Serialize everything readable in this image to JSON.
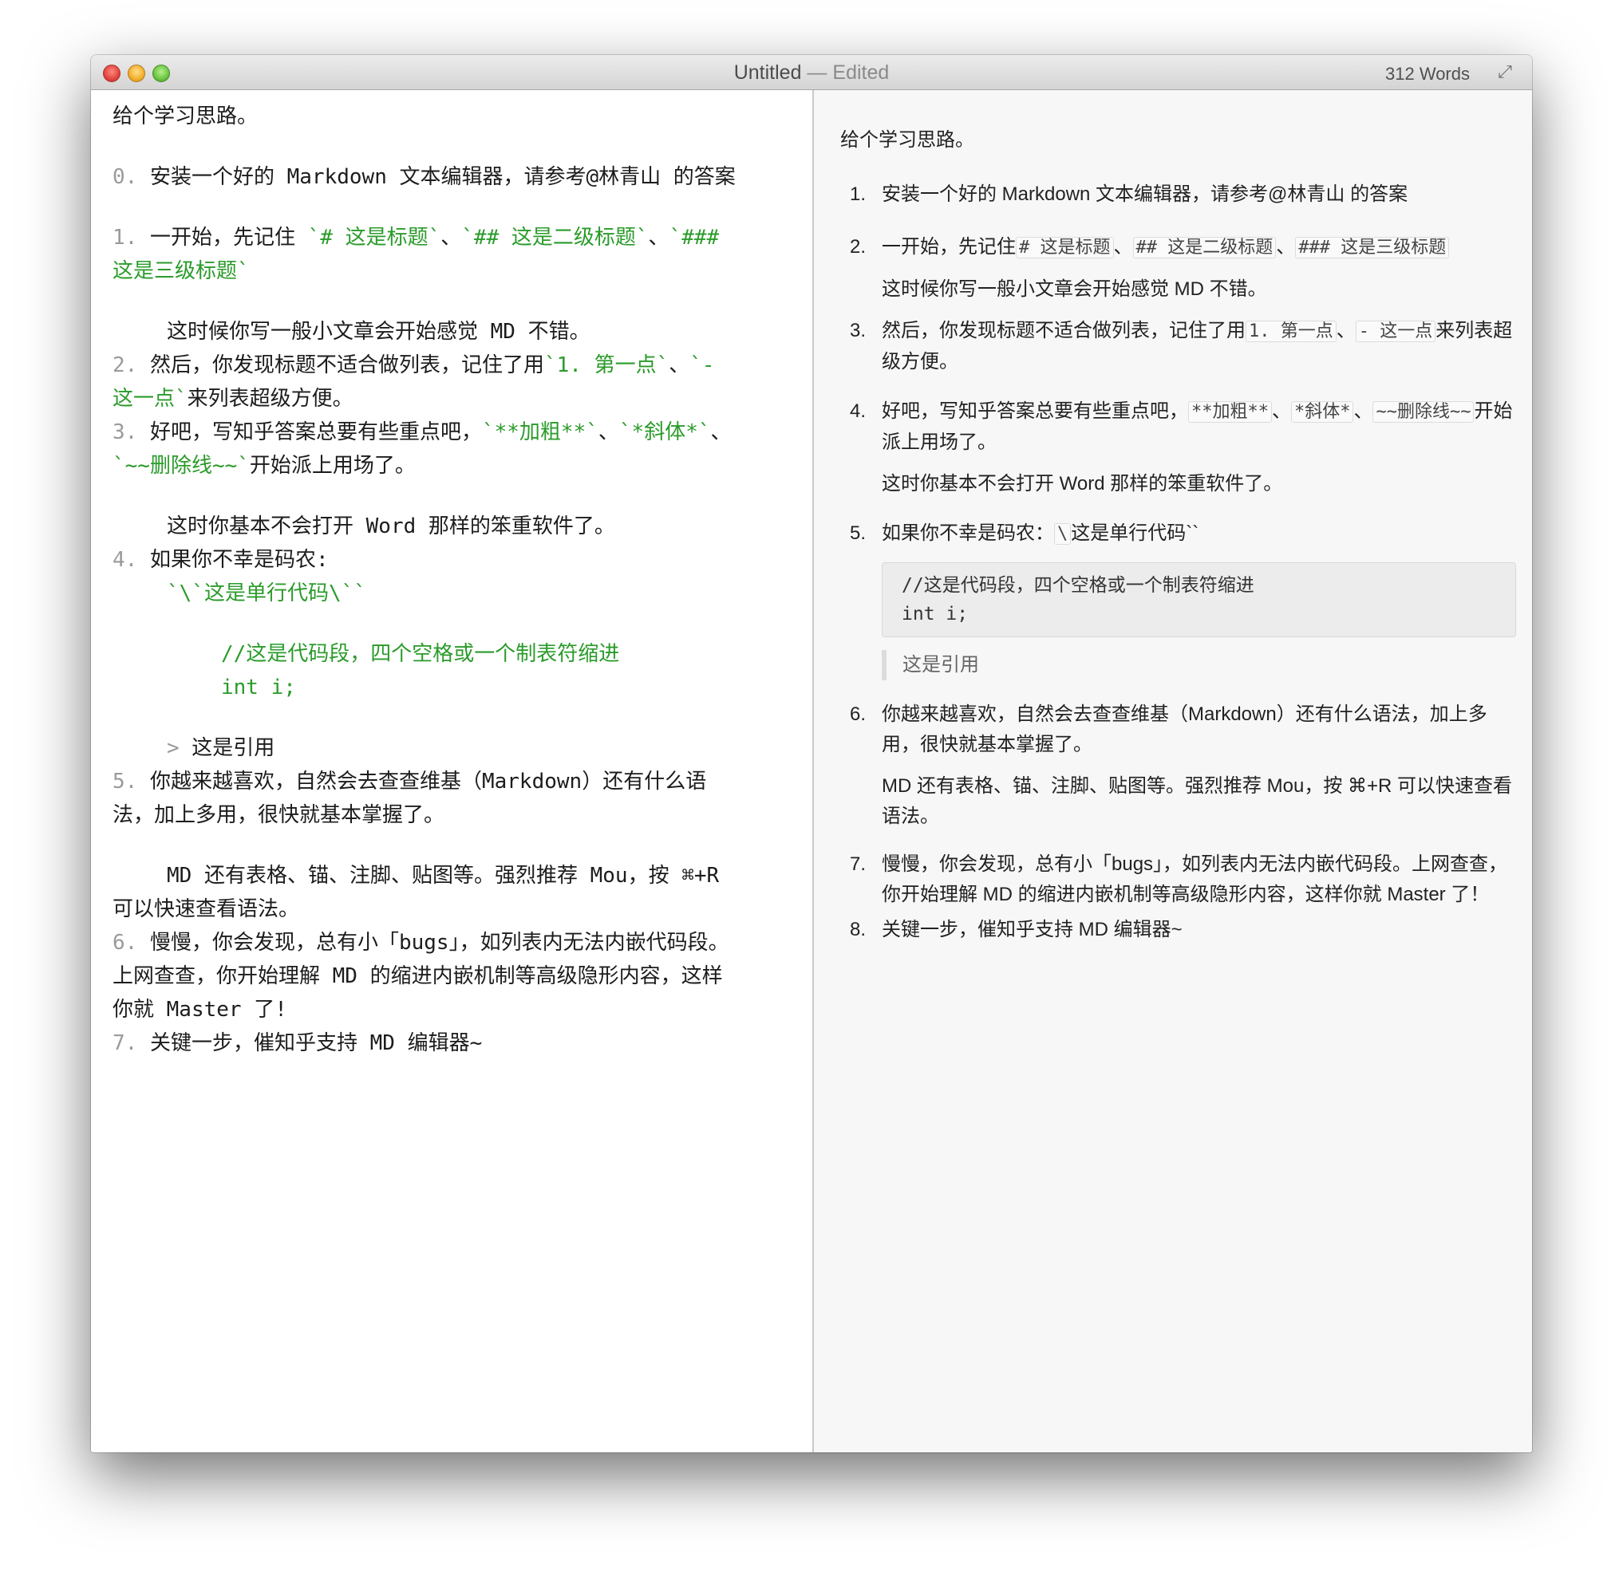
{
  "window": {
    "title": "Untitled",
    "title_sep": " — ",
    "title_state": "Edited",
    "word_count": "312 Words",
    "fullscreen_icon": "⤢"
  },
  "editor": {
    "intro": "给个学习思路。",
    "item0_num": "0.",
    "item0_text": " 安装一个好的 Markdown 文本编辑器，请参考@林青山 的答案",
    "item1_num": "1.",
    "item1_a": " 一开始，先记住 ",
    "item1_code1": "`# 这是标题`",
    "item1_sep1": "、",
    "item1_code2": "`## 这是二级标题`",
    "item1_sep2": "、",
    "item1_code3a": "`###",
    "item1_code3b": "这是三级标题`",
    "item1_para": "这时候你写一般小文章会开始感觉 MD 不错。",
    "item2_num": "2.",
    "item2_a": " 然后，你发现标题不适合做列表，记住了用",
    "item2_code1": "`1. 第一点`",
    "item2_sep": "、",
    "item2_code2a": "`-",
    "item2_code2b": "这一点`",
    "item2_b": "来列表超级方便。",
    "item3_num": "3.",
    "item3_a": " 好吧，写知乎答案总要有些重点吧，",
    "item3_code1": "`**加粗**`",
    "item3_sep1": "、",
    "item3_code2": "`*斜体*`",
    "item3_sep2": "、",
    "item3_code3": "`~~删除线~~`",
    "item3_b": "开始派上用场了。",
    "item3_para": "这时你基本不会打开 Word 那样的笨重软件了。",
    "item4_num": "4.",
    "item4_a": " 如果你不幸是码农:",
    "item4_inline": "`\\`这是单行代码\\``",
    "item4_code1": "//这是代码段，四个空格或一个制表符缩进",
    "item4_code2": "int i;",
    "item4_quote_mark": ">",
    "item4_quote": " 这是引用",
    "item5_num": "5.",
    "item5_a": " 你越来越喜欢，自然会去查查维基（Markdown）还有什么语",
    "item5_b": "法，加上多用，很快就基本掌握了。",
    "item5_para_a": "MD 还有表格、锚、注脚、贴图等。强烈推荐 Mou，按 ⌘+R",
    "item5_para_b": "可以快速查看语法。",
    "item6_num": "6.",
    "item6_a": " 慢慢，你会发现，总有小「bugs」，如列表内无法内嵌代码段。",
    "item6_b": "上网查查，你开始理解 MD 的缩进内嵌机制等高级隐形内容，这样",
    "item6_c": "你就 Master 了!",
    "item7_num": "7.",
    "item7_a": " 关键一步，催知乎支持 MD 编辑器~"
  },
  "preview": {
    "intro": "给个学习思路。",
    "i1_n": "1.",
    "i1": "安装一个好的 Markdown 文本编辑器，请参考@林青山 的答案",
    "i2_n": "2.",
    "i2_a": "一开始，先记住",
    "i2_c1": "# 这是标题",
    "i2_s1": "、",
    "i2_c2": "## 这是二级标题",
    "i2_s2": "、",
    "i2_c3": "### 这是三级标题",
    "i2_para": "这时候你写一般小文章会开始感觉 MD 不错。",
    "i3_n": "3.",
    "i3_a": "然后，你发现标题不适合做列表，记住了用",
    "i3_c1": "1. 第一点",
    "i3_s": "、",
    "i3_c2": "- 这一点",
    "i3_b": "来列表超级方便。",
    "i4_n": "4.",
    "i4_a": "好吧，写知乎答案总要有些重点吧，",
    "i4_c1": "**加粗**",
    "i4_s1": "、",
    "i4_c2": "*斜体*",
    "i4_s2": "、",
    "i4_c3": "~~删除线~~",
    "i4_b": "开始派上用场了。",
    "i4_para": "这时你基本不会打开 Word 那样的笨重软件了。",
    "i5_n": "5.",
    "i5_a": "如果你不幸是码农：",
    "i5_c": "\\",
    "i5_b": "这是单行代码``",
    "i5_code1": "//这是代码段，四个空格或一个制表符缩进",
    "i5_code2": "int i;",
    "i5_quote": "这是引用",
    "i6_n": "6.",
    "i6": "你越来越喜欢，自然会去查查维基（Markdown）还有什么语法，加上多用，很快就基本掌握了。",
    "i6_para": "MD 还有表格、锚、注脚、贴图等。强烈推荐 Mou，按 ⌘+R 可以快速查看语法。",
    "i7_n": "7.",
    "i7": "慢慢，你会发现，总有小「bugs」，如列表内无法内嵌代码段。上网查查，你开始理解 MD 的缩进内嵌机制等高级隐形内容，这样你就 Master 了！",
    "i8_n": "8.",
    "i8": "关键一步，催知乎支持 MD 编辑器~"
  }
}
